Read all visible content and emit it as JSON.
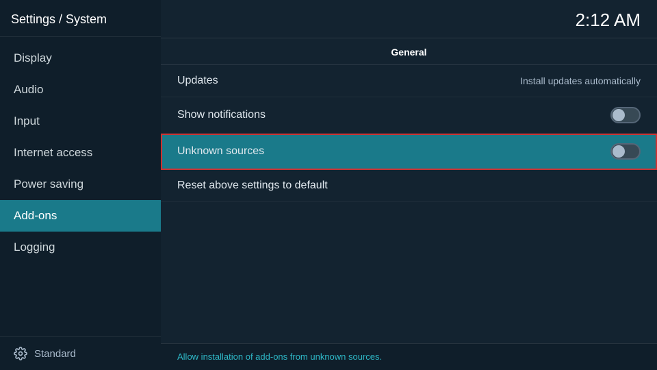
{
  "header": {
    "title": "Settings / System",
    "clock": "2:12 AM"
  },
  "sidebar": {
    "items": [
      {
        "id": "display",
        "label": "Display",
        "active": false
      },
      {
        "id": "audio",
        "label": "Audio",
        "active": false
      },
      {
        "id": "input",
        "label": "Input",
        "active": false
      },
      {
        "id": "internet-access",
        "label": "Internet access",
        "active": false
      },
      {
        "id": "power-saving",
        "label": "Power saving",
        "active": false
      },
      {
        "id": "add-ons",
        "label": "Add-ons",
        "active": true
      },
      {
        "id": "logging",
        "label": "Logging",
        "active": false
      }
    ],
    "footer": {
      "label": "Standard",
      "icon": "gear-icon"
    }
  },
  "main": {
    "section_label": "General",
    "settings": [
      {
        "id": "updates",
        "label": "Updates",
        "value": "Install updates automatically",
        "type": "value",
        "highlighted": false
      },
      {
        "id": "show-notifications",
        "label": "Show notifications",
        "type": "toggle",
        "toggled": false,
        "highlighted": false
      },
      {
        "id": "unknown-sources",
        "label": "Unknown sources",
        "type": "toggle",
        "toggled": false,
        "highlighted": true
      },
      {
        "id": "reset-settings",
        "label": "Reset above settings to default",
        "type": "none",
        "highlighted": false
      }
    ],
    "status_text": "Allow installation of add-ons from unknown sources."
  }
}
